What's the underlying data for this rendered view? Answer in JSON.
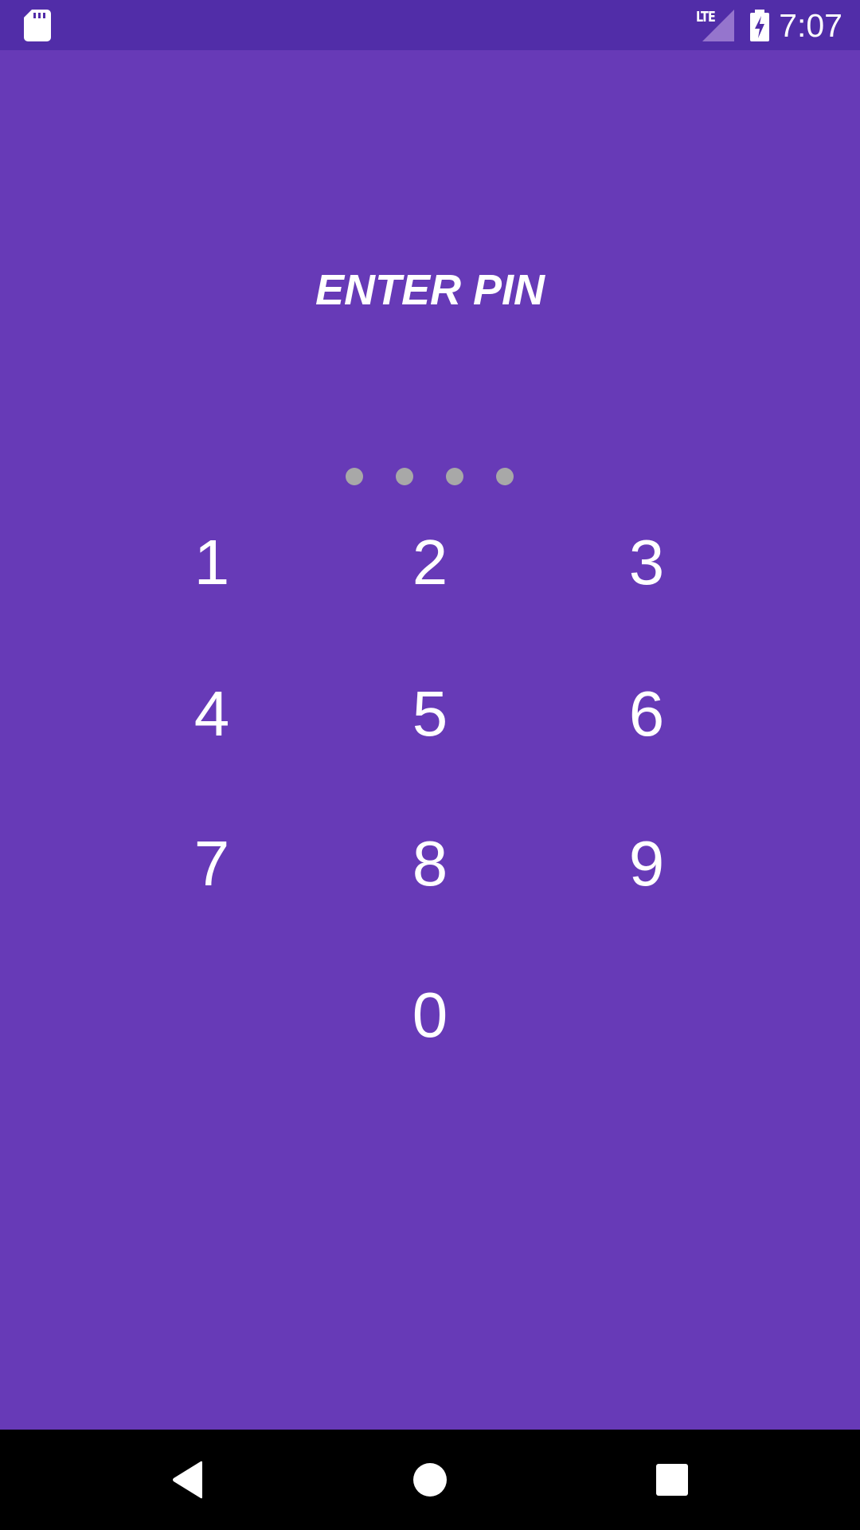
{
  "status_bar": {
    "network_label": "LTE",
    "time": "7:07",
    "icons": [
      "sd-card-icon",
      "signal-icon",
      "battery-charging-icon"
    ]
  },
  "pin_screen": {
    "title": "ENTER PIN",
    "pin_length": 4,
    "digits_entered": 0,
    "keys": {
      "k1": "1",
      "k2": "2",
      "k3": "3",
      "k4": "4",
      "k5": "5",
      "k6": "6",
      "k7": "7",
      "k8": "8",
      "k9": "9",
      "k0": "0"
    }
  },
  "navigation_bar": {
    "icons": [
      "back-icon",
      "home-icon",
      "recents-icon"
    ]
  },
  "colors": {
    "background": "#673ab7",
    "status_bar": "#512da8",
    "pin_dot_empty": "#a8a8a8",
    "text": "#ffffff",
    "nav_bar": "#000000"
  }
}
